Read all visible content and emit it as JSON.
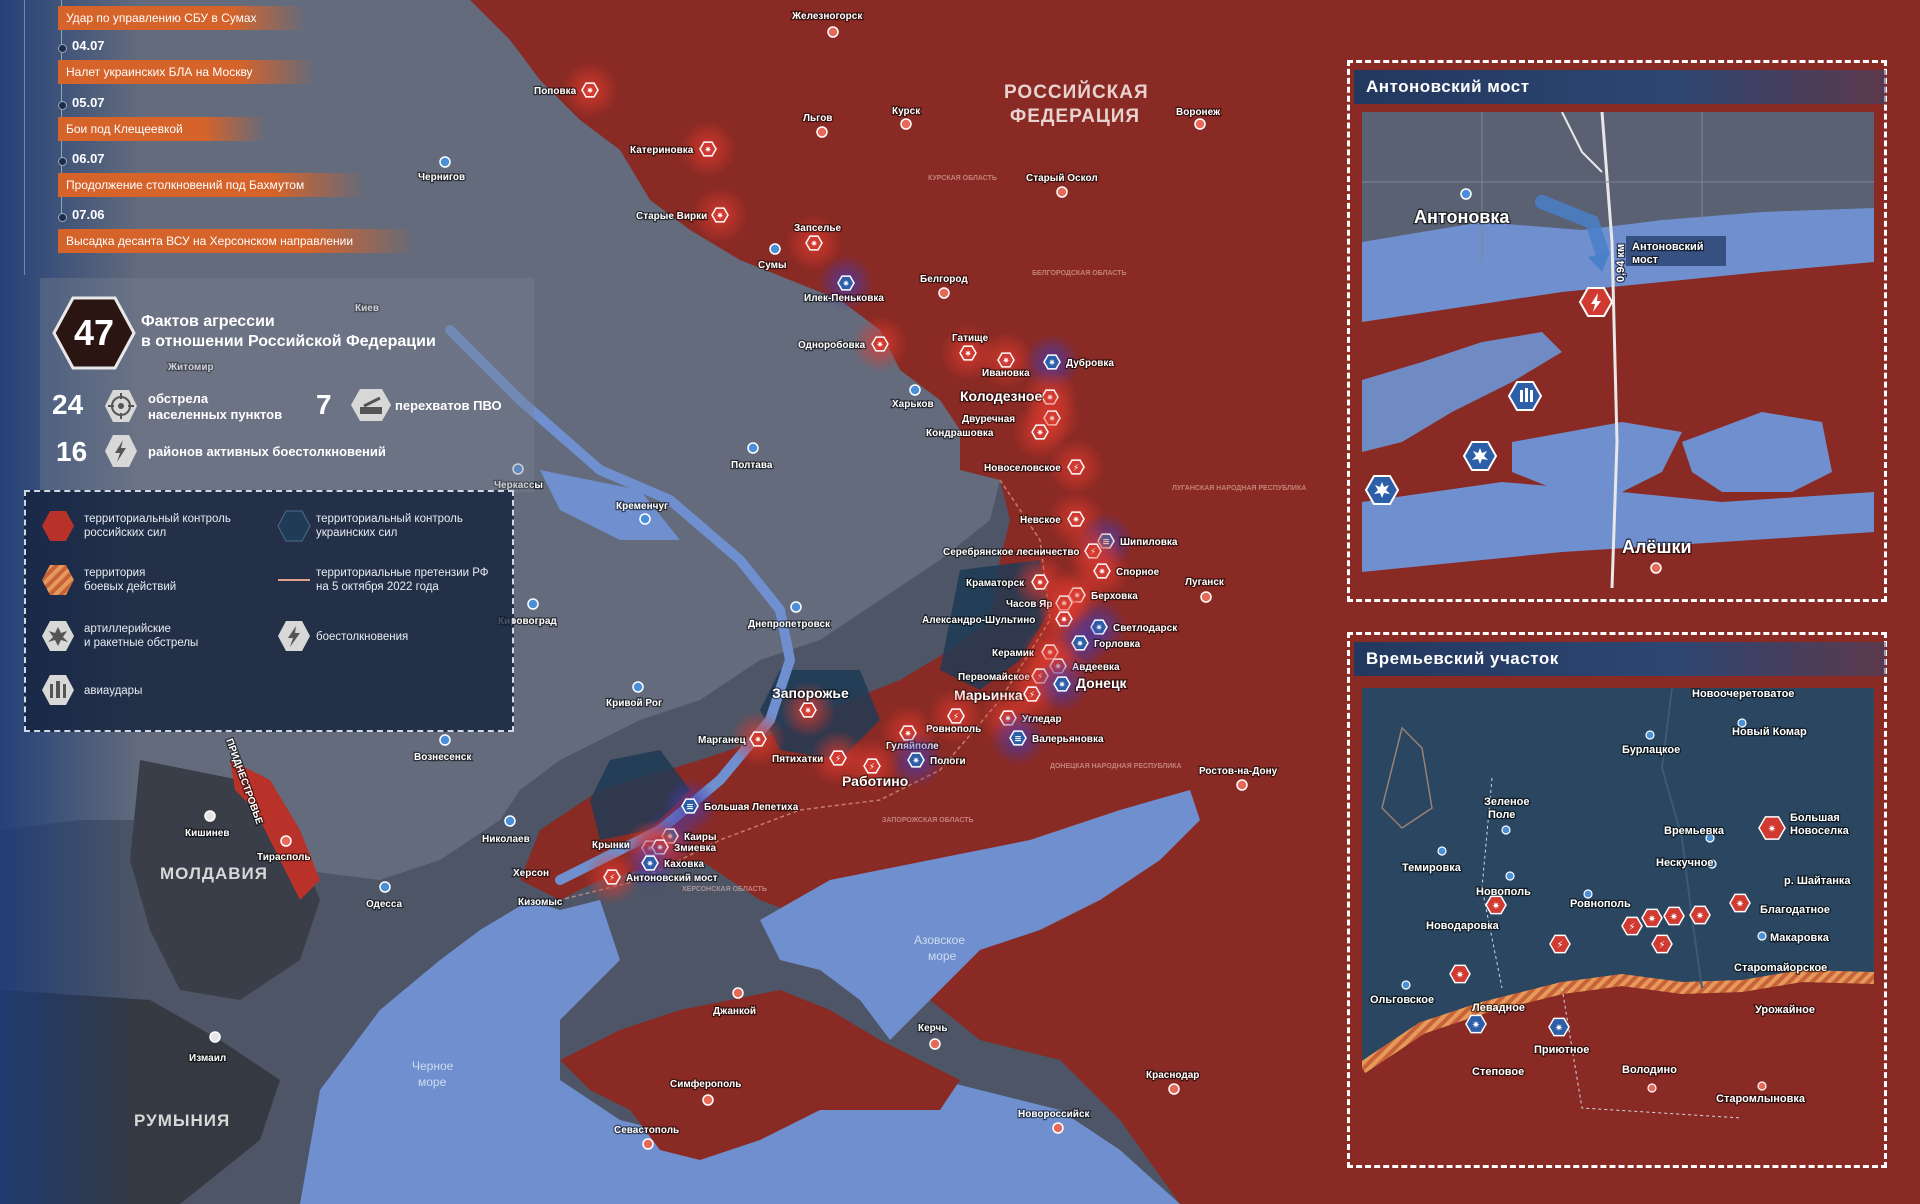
{
  "timeline": {
    "top_event": "Удар по управлению СБУ в Сумах",
    "events": [
      {
        "date": "04.07",
        "text": "Налет украинских БЛА на Москву"
      },
      {
        "date": "05.07",
        "text": "Бои под Клещеевкой"
      },
      {
        "date": "06.07",
        "text": "Продолжение столкновений под Бахмутом"
      },
      {
        "date": "07.06",
        "text": "Высадка десанта ВСУ на Херсонском направлении"
      }
    ]
  },
  "stats": {
    "total": "47",
    "total_label_1": "Фактов агрессии",
    "total_label_2": "в отношении Российской Федерации",
    "shelling_count": "24",
    "shelling_label_1": "обстрела",
    "shelling_label_2": "населенных пунктов",
    "intercept_count": "7",
    "intercept_label": "перехватов ПВО",
    "combat_count": "16",
    "combat_label": "районов активных боестолкновений"
  },
  "legend": {
    "ru_control_1": "территориальный контроль",
    "ru_control_2": "российских сил",
    "ua_control_1": "территориальный контроль",
    "ua_control_2": "украинских сил",
    "combat_zone_1": "территория",
    "combat_zone_2": "боевых действий",
    "claims_1": "территориальные претензии РФ",
    "claims_2": "на 5 октября 2022 года",
    "artillery_1": "артиллерийские",
    "artillery_2": "и ракетные обстрелы",
    "clashes": "боестолкновения",
    "airstrikes": "авиаудары"
  },
  "colors": {
    "russian_control": "#8a2a24",
    "ukrainian_control": "#1f3b55",
    "neutral_land": "#6a7282",
    "sea": "#6f8fce",
    "accent": "#d5632a"
  },
  "map": {
    "country_rf_1": "РОССИЙСКАЯ",
    "country_rf_2": "ФЕДЕРАЦИЯ",
    "moldova": "МОЛДАВИЯ",
    "romania": "РУМЫНИЯ",
    "black_sea_1": "Черное",
    "black_sea_2": "море",
    "azov_1": "Азовское",
    "azov_2": "море",
    "pridnestrovie": "ПРИДНЕСТРОВЬЕ",
    "cities": [
      "Железногорск",
      "Курск",
      "Льгов",
      "Воронеж",
      "Старый Оскол",
      "Белгород",
      "Чернигов",
      "Сумы",
      "Харьков",
      "Полтава",
      "Кременчуг",
      "Днепропетровск",
      "Кривой Рог",
      "Вознесенск",
      "Николаев",
      "Одесса",
      "Херсон",
      "Кизомыс",
      "Черкассы",
      "Кировоград",
      "Луганск",
      "Ростов-на-Дону",
      "Кишинев",
      "Тирасполь",
      "Измаил",
      "Джанкой",
      "Симферополь",
      "Севастополь",
      "Керчь",
      "Краснодар",
      "Новороссийск",
      "Киев",
      "Житомир"
    ],
    "events": [
      "Поповка",
      "Катериновка",
      "Старые Вирки",
      "Запселье",
      "Илек-Пеньковка",
      "Одноробовка",
      "Гатище",
      "Ивановка",
      "Дубровка",
      "Колодезное",
      "Двуречная",
      "Кондрашовка",
      "Новоселовское",
      "Невское",
      "Шипиловка",
      "Серебрянское лесничество",
      "Спорное",
      "Краматорск",
      "Берховка",
      "Часов Яр",
      "Александро-Шультино",
      "Светлодарск",
      "Горловка",
      "Керамик",
      "Авдеевка",
      "Первомайское",
      "Марьинка",
      "Донецк",
      "Угледар",
      "Ровнополь",
      "Валерьяновка",
      "Гуляйполе",
      "Пологи",
      "Работино",
      "Пятихатки",
      "Запорожье",
      "Марганец",
      "Большая Лепетиха",
      "Каиры",
      "Крынки",
      "Змиевка",
      "Каховка",
      "Антоновский мост"
    ],
    "regions": [
      "КУРСКАЯ ОБЛАСТЬ",
      "БЕЛГОРОДСКАЯ ОБЛАСТЬ",
      "ЛУГАНСКАЯ НАРОДНАЯ РЕСПУБЛИКА",
      "ДОНЕЦКАЯ НАРОДНАЯ РЕСПУБЛИКА",
      "ЗАПОРОЖСКАЯ ОБЛАСТЬ",
      "ХЕРСОНСКАЯ ОБЛАСТЬ"
    ]
  },
  "inset_antonovsky": {
    "title": "Антоновский мост",
    "antonovka": "Антоновка",
    "aleshki": "Алёшки",
    "bridge_1": "Антоновский",
    "bridge_2": "мост",
    "distance": "0,94 км"
  },
  "inset_vremevsky": {
    "title": "Времьевский участок",
    "places": [
      "Новоочеретоватое",
      "Бурлацкое",
      "Новый Комар",
      "Зеленое",
      "Поле",
      "Большая",
      "Новоселка",
      "Времьевка",
      "Темировка",
      "Нескучное",
      "Новополь",
      "р. Шайтанка",
      "Ровнополь",
      "Благодатное",
      "Новодаровка",
      "Макаровка",
      "Староmайорское",
      "Ольговское",
      "Левадное",
      "Урожайное",
      "Приютное",
      "Степовое",
      "Володино",
      "Старомлыновка"
    ]
  }
}
